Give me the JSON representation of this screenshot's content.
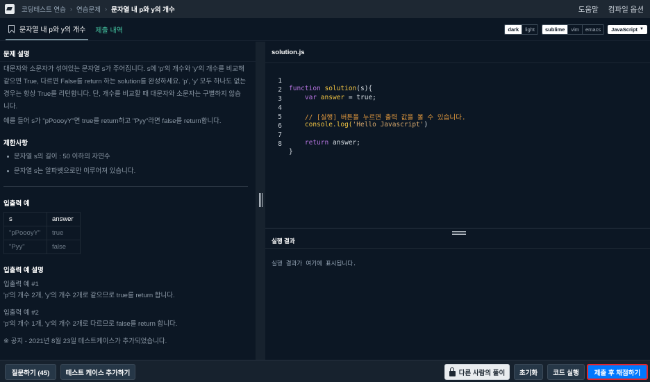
{
  "breadcrumb": {
    "items": [
      "코딩테스트 연습",
      "연습문제",
      "문자열 내 p와 y의 개수"
    ]
  },
  "topbar": {
    "help": "도움말",
    "compile_options": "컴파일 옵션"
  },
  "tabs": {
    "problem": "문자열 내 p와 y의 개수",
    "submissions": "제출 내역"
  },
  "toggles": {
    "theme": [
      "dark",
      "light"
    ],
    "keymap": [
      "sublime",
      "vim",
      "emacs"
    ],
    "language": "JavaScript"
  },
  "problem": {
    "section_title": "문제 설명",
    "description_1": "대문자와 소문자가 섞여있는 문자열 s가 주어집니다. s에 'p'의 개수와 'y'의 개수를 비교해 같으면 True, 다르면 False를 return 하는 solution를 완성하세요. 'p', 'y' 모두 하나도 없는 경우는 항상 True를 리턴합니다. 단, 개수를 비교할 때 대문자와 소문자는 구별하지 않습니다.",
    "description_2": "예를 들어 s가 \"pPoooyY\"면 true를 return하고 \"Pyy\"라면 false를 return합니다.",
    "constraints_title": "제한사항",
    "constraints": [
      "문자열 s의 길이 : 50 이하의 자연수",
      "문자열 s는 알파벳으로만 이루어져 있습니다."
    ],
    "io_title": "입출력 예",
    "io_headers": [
      "s",
      "answer"
    ],
    "io_rows": [
      [
        "\"pPoooyY\"",
        "true"
      ],
      [
        "\"Pyy\"",
        "false"
      ]
    ],
    "io_explain_title": "입출력 예 설명",
    "example1_title": "입출력 예 #1",
    "example1_text": "'p'의 개수 2개, 'y'의 개수 2개로 같으므로 true를 return 합니다.",
    "example2_title": "입출력 예 #2",
    "example2_text": "'p'의 개수 1개, 'y'의 개수 2개로 다르므로 false를 return 합니다.",
    "notice": "※ 공지 - 2021년 8월 23일 테스트케이스가 추가되었습니다."
  },
  "editor": {
    "filename": "solution.js",
    "line_numbers": [
      "1",
      "2",
      "3",
      "4",
      "5",
      "6",
      "7",
      "8"
    ],
    "line1": {
      "kw": "function",
      "name": "solution",
      "rest": "(s){"
    },
    "line2": {
      "kw": "var",
      "name": "answer",
      "rest": " = true;"
    },
    "line4": "// [실행] 버튼을 누르면 출력 값을 볼 수 있습니다.",
    "line5": {
      "obj": "console.log(",
      "str": "'Hello Javascript'",
      "end": ")"
    },
    "line7": {
      "kw": "return",
      "rest": " answer;"
    },
    "line8": "}"
  },
  "result": {
    "title": "실행 결과",
    "placeholder": "실행 결과가 여기에 표시됩니다."
  },
  "bottom": {
    "questions": "질문하기 (45)",
    "add_testcase": "테스트 케이스 추가하기",
    "others_solutions": "다른 사람의 풀이",
    "reset": "초기화",
    "run": "코드 실행",
    "submit": "제출 후 채점하기"
  },
  "colors": {
    "background": "#0c1724",
    "accent_green": "#44c4a1",
    "submit_blue": "#0078ff",
    "highlight_red": "#e4252b"
  }
}
